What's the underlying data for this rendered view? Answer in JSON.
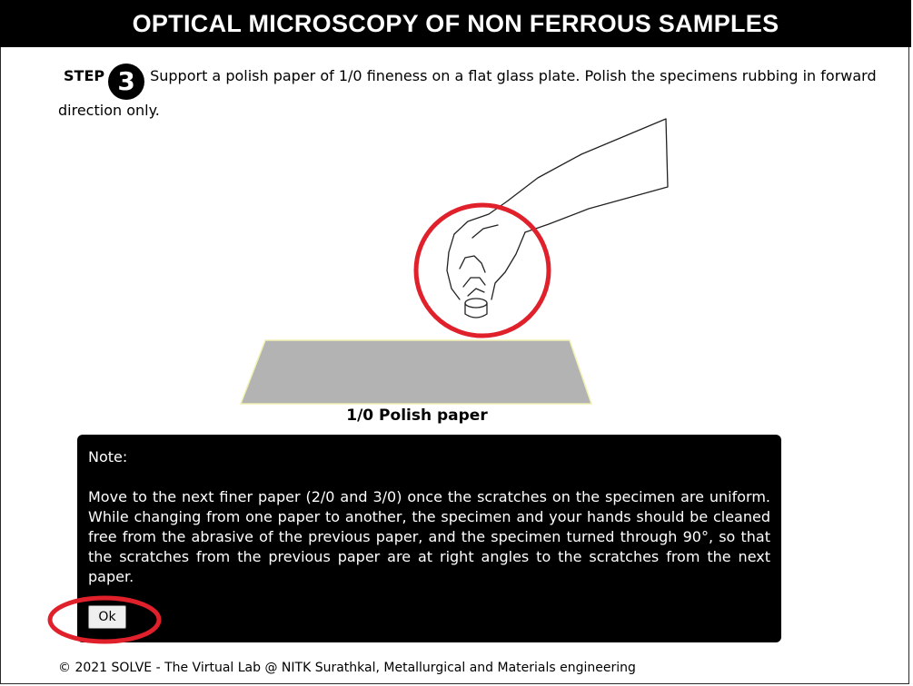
{
  "header": {
    "title": "OPTICAL MICROSCOPY OF NON FERROUS SAMPLES"
  },
  "step": {
    "label": "STEP",
    "number": "3",
    "text": "Support a polish paper of 1/0 fineness on a flat glass plate. Polish the specimens rubbing in forward direction only."
  },
  "illustration": {
    "paper_label": "1/0 Polish paper",
    "paper_color": "#b3b3b3",
    "paper_edge_color": "#f0f0b0",
    "highlight_color": "#e0202a"
  },
  "note": {
    "title": "Note:",
    "body": "Move to the next finer paper (2/0 and 3/0) once the scratches on the specimen are uniform. While changing from one paper to another, the specimen and your hands should be cleaned free from the abrasive of the previous paper, and the specimen turned through 90°, so that the scratches from the previous paper are at right angles to the scratches from the next paper.",
    "ok_label": "Ok"
  },
  "footer": {
    "text": "© 2021 SOLVE - The Virtual Lab @ NITK Surathkal, Metallurgical and Materials engineering"
  }
}
